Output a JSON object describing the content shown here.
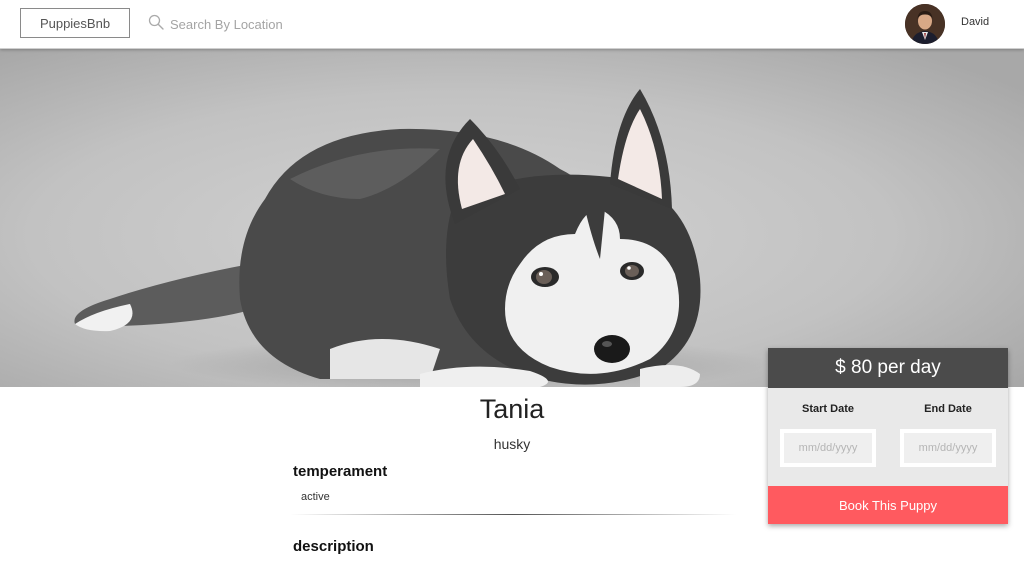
{
  "header": {
    "brand": "PuppiesBnb",
    "search_placeholder": "Search By Location",
    "user_name": "David"
  },
  "hero": {
    "image_subject": "husky puppy lying down"
  },
  "puppy": {
    "name": "Tania",
    "breed": "husky",
    "temperament_label": "temperament",
    "temperament_value": "active",
    "description_label": "description"
  },
  "booking": {
    "price": "$ 80 per day",
    "start_label": "Start Date",
    "end_label": "End Date",
    "start_placeholder": "mm/dd/yyyy",
    "end_placeholder": "mm/dd/yyyy",
    "button_label": "Book This Puppy"
  },
  "colors": {
    "accent": "#ff5a5f",
    "price_bar": "#4b4b4b",
    "card_bg": "#e9e9e9"
  }
}
